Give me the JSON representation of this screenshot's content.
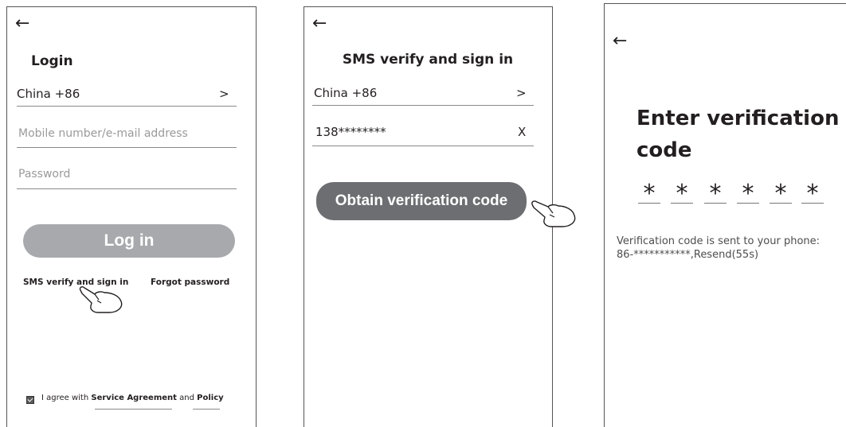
{
  "login": {
    "back_icon": "back-arrow-icon",
    "title": "Login",
    "country": "China +86",
    "country_chevron": ">",
    "username_placeholder": "Mobile number/e-mail address",
    "password_placeholder": "Password",
    "login_button": "Log in",
    "sms_link": "SMS verify and sign in",
    "forgot_link": "Forgot password",
    "agree_prefix": "I agree with",
    "service_agreement": "Service Agreement",
    "and_text": "and",
    "policy": "Policy"
  },
  "sms": {
    "back_icon": "back-arrow-icon",
    "title": "SMS verify and sign in",
    "country": "China +86",
    "country_chevron": ">",
    "phone_value": "138********",
    "clear_label": "X",
    "obtain_button": "Obtain verification code"
  },
  "verify": {
    "back_icon": "back-arrow-icon",
    "title_line1": "Enter verification",
    "title_line2": "code",
    "digits": [
      "*",
      "*",
      "*",
      "*",
      "*",
      "*"
    ],
    "message_line1": "Verification code is sent to your phone:",
    "message_line2": "86-***********,Resend(55s)"
  },
  "colors": {
    "button_light": "#a7a9ac",
    "button_dark": "#6d6e71",
    "text": "#231f20"
  }
}
